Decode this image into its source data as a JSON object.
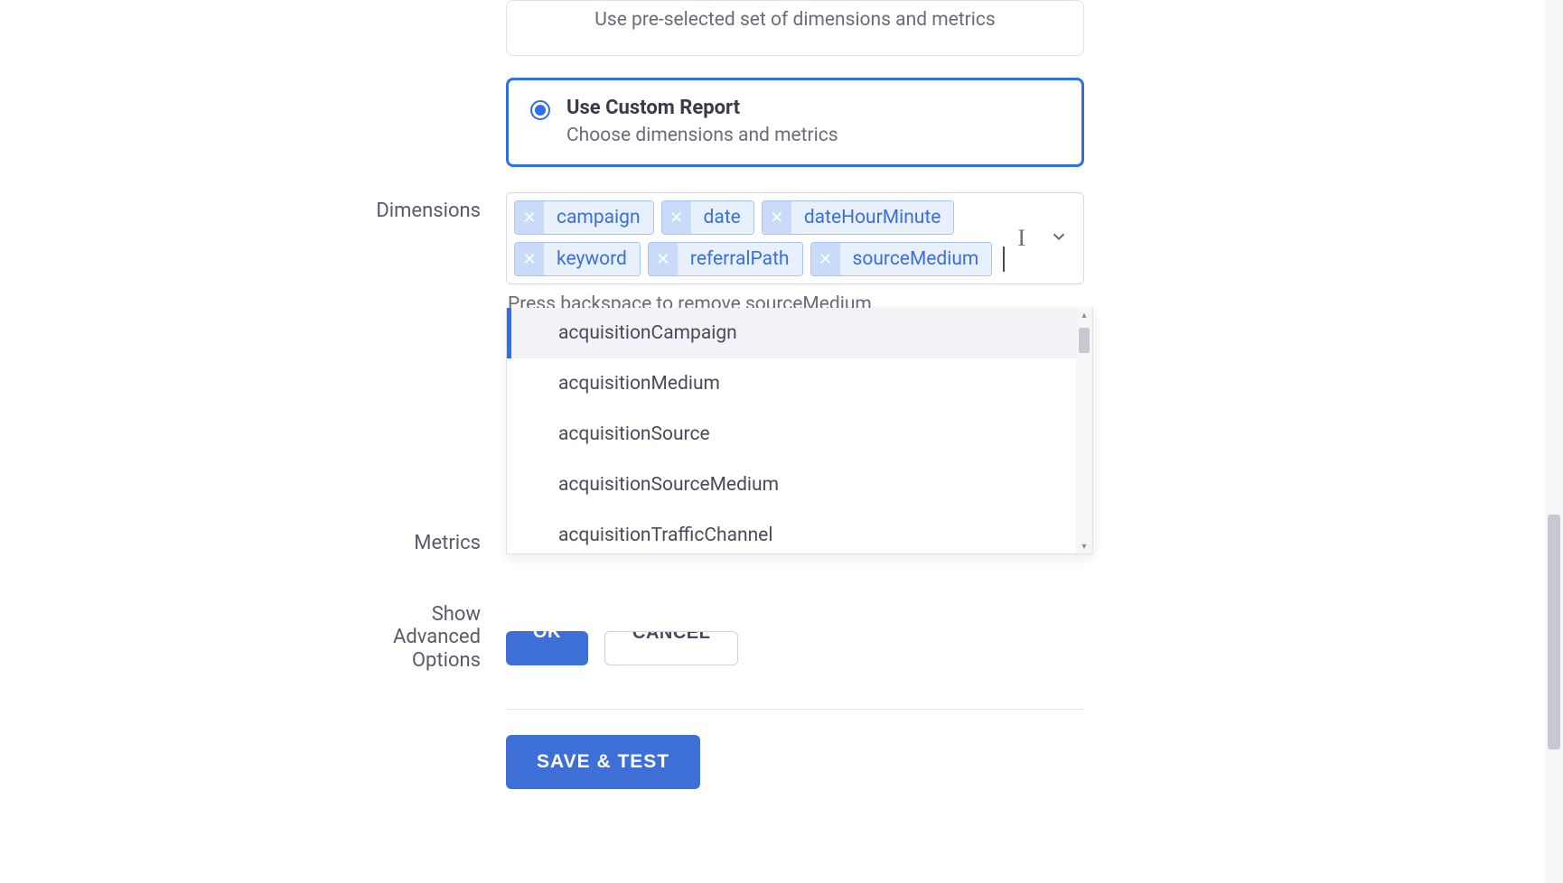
{
  "preselected": {
    "desc": "Use pre-selected set of dimensions and metrics"
  },
  "customReport": {
    "title": "Use Custom Report",
    "desc": "Choose dimensions and metrics"
  },
  "labels": {
    "dimensions": "Dimensions",
    "metrics": "Metrics",
    "showAdvanced1": "Show Advanced",
    "showAdvanced2": "Options"
  },
  "dimensions": {
    "chips": [
      "campaign",
      "date",
      "dateHourMinute",
      "keyword",
      "referralPath",
      "sourceMedium"
    ],
    "helper": "Press backspace to remove sourceMedium",
    "options": [
      "acquisitionCampaign",
      "acquisitionMedium",
      "acquisitionSource",
      "acquisitionSourceMedium",
      "acquisitionTrafficChannel"
    ]
  },
  "buttons": {
    "ok": "OK",
    "cancel": "CANCEL",
    "saveTest": "SAVE & TEST"
  }
}
